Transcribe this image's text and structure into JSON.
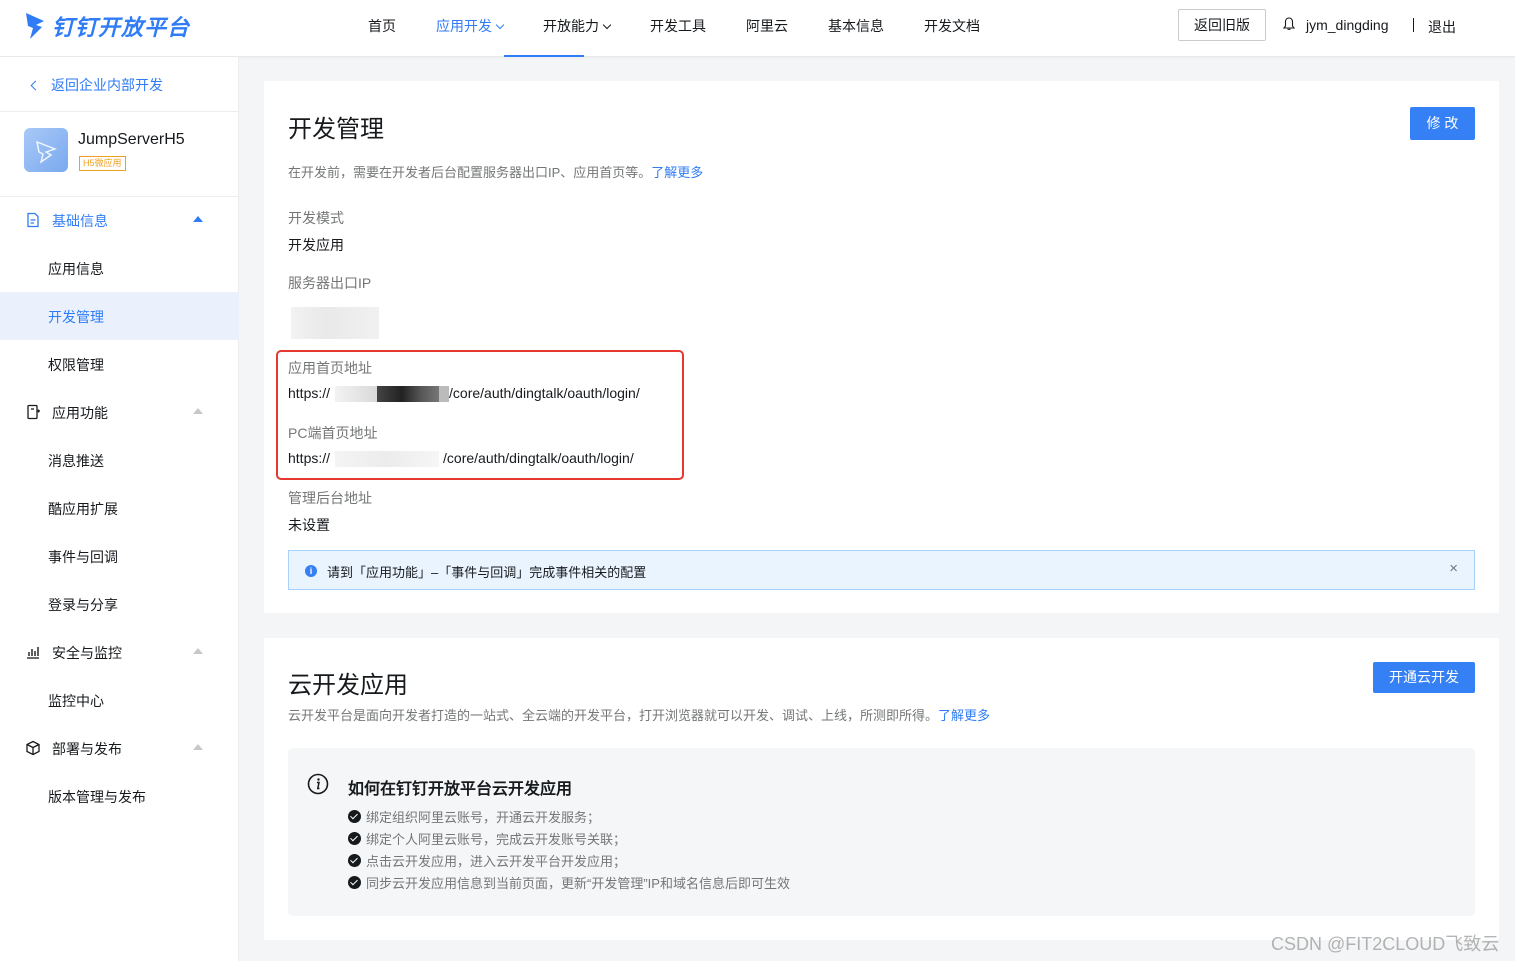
{
  "brand": {
    "name": "钉钉开放平台",
    "accent": "#2f7cf6"
  },
  "nav": {
    "items": [
      {
        "label": "首页",
        "dropdown": false,
        "active": false
      },
      {
        "label": "应用开发",
        "dropdown": true,
        "active": true
      },
      {
        "label": "开放能力",
        "dropdown": true,
        "active": false
      },
      {
        "label": "开发工具",
        "dropdown": false,
        "active": false
      },
      {
        "label": "阿里云",
        "dropdown": false,
        "active": false
      },
      {
        "label": "基本信息",
        "dropdown": false,
        "active": false
      },
      {
        "label": "开发文档",
        "dropdown": false,
        "active": false
      }
    ],
    "old_version": "返回旧版",
    "username": "jym_dingding",
    "logout": "退出"
  },
  "sidebar": {
    "back": "返回企业内部开发",
    "app": {
      "name": "JumpServerH5",
      "tag": "H5微应用"
    },
    "groups": [
      {
        "label": "基础信息",
        "icon": "document-icon",
        "expanded": true,
        "items": [
          "应用信息",
          "开发管理",
          "权限管理"
        ]
      },
      {
        "label": "应用功能",
        "icon": "app-function-icon",
        "expanded": true,
        "items": [
          "消息推送",
          "酷应用扩展",
          "事件与回调",
          "登录与分享"
        ]
      },
      {
        "label": "安全与监控",
        "icon": "chart-icon",
        "expanded": true,
        "items": [
          "监控中心"
        ]
      },
      {
        "label": "部署与发布",
        "icon": "cube-icon",
        "expanded": true,
        "items": [
          "版本管理与发布"
        ]
      }
    ],
    "selected": "开发管理"
  },
  "dev": {
    "title": "开发管理",
    "edit": "修 改",
    "desc": "在开发前，需要在开发者后台配置服务器出口IP、应用首页等。",
    "learn_more": "了解更多",
    "fields": {
      "mode_label": "开发模式",
      "mode_value": "开发应用",
      "ip_label": "服务器出口IP",
      "home_label": "应用首页地址",
      "home_prefix": "https://",
      "home_suffix": "/core/auth/dingtalk/oauth/login/",
      "pc_label": "PC端首页地址",
      "pc_prefix": "https://",
      "pc_suffix": "/core/auth/dingtalk/oauth/login/",
      "admin_label": "管理后台地址",
      "admin_value": "未设置"
    },
    "alert": "请到「应用功能」–「事件与回调」完成事件相关的配置"
  },
  "cloud": {
    "title": "云开发应用",
    "button": "开通云开发",
    "desc": "云开发平台是面向开发者打造的一站式、全云端的开发平台，打开浏览器就可以开发、调试、上线，所测即所得。",
    "learn_more": "了解更多",
    "guide_title": "如何在钉钉开放平台云开发应用",
    "steps": [
      "绑定组织阿里云账号，开通云开发服务；",
      "绑定个人阿里云账号，完成云开发账号关联；",
      "点击云开发应用，进入云开发平台开发应用；",
      "同步云开发应用信息到当前页面，更新“开发管理”IP和域名信息后即可生效"
    ]
  },
  "watermark": "CSDN @FIT2CLOUD飞致云"
}
